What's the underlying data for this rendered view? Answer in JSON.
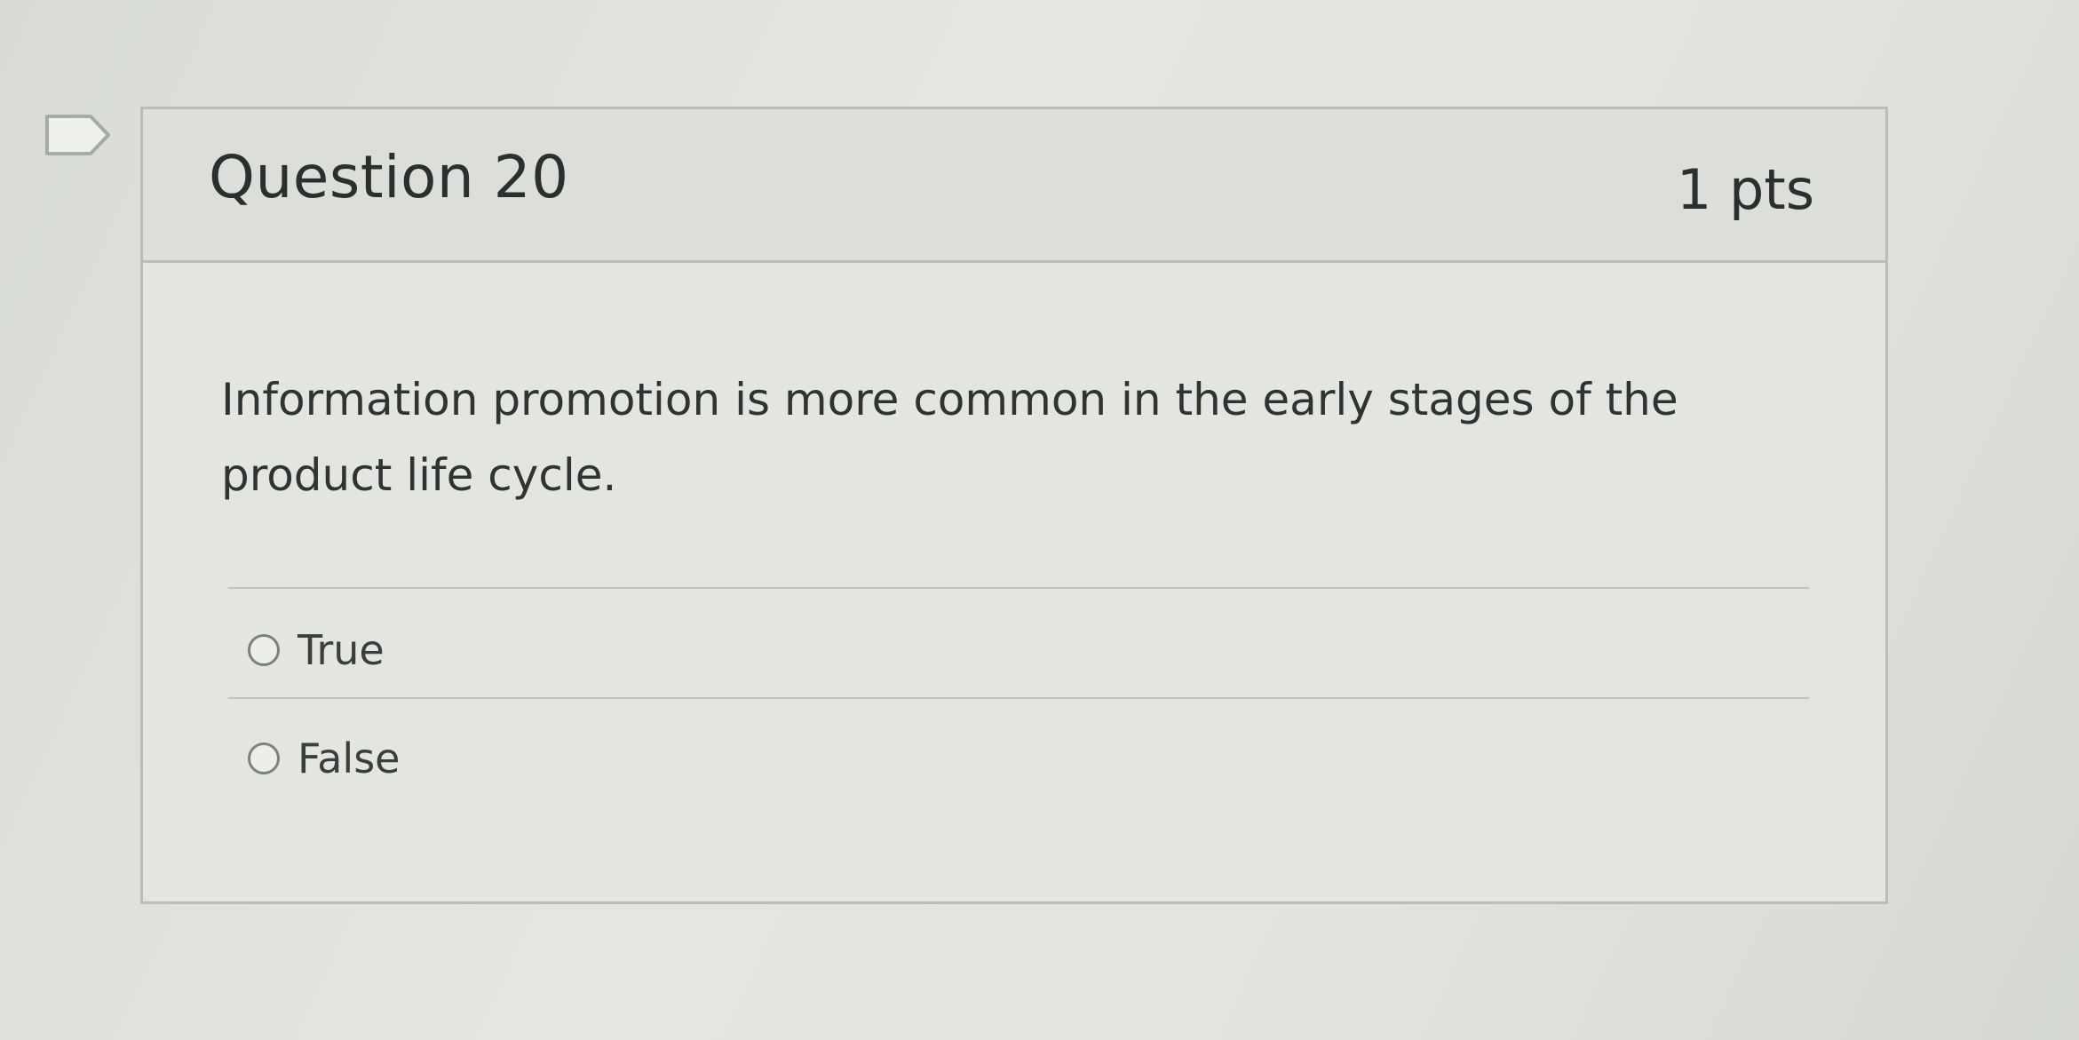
{
  "question": {
    "title": "Question 20",
    "points": "1 pts",
    "text": "Information promotion is more common in the early stages of the product life cycle."
  },
  "answers": [
    {
      "label": "True",
      "selected": false
    },
    {
      "label": "False",
      "selected": false
    }
  ],
  "icons": {
    "flag": "flag-question-icon",
    "radio": "radio-button-icon"
  }
}
